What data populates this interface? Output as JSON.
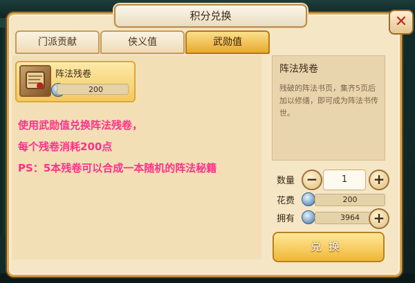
{
  "dialog": {
    "title": "积分兑换"
  },
  "tabs": [
    {
      "label": "门派贡献",
      "active": false
    },
    {
      "label": "侠义值",
      "active": false
    },
    {
      "label": "武勋值",
      "active": true
    }
  ],
  "item": {
    "name": "阵法残卷",
    "price": "200"
  },
  "description": {
    "line1": "使用武勋值兑换阵法残卷，",
    "line2": "每个残卷消耗200点",
    "line3": "PS：5本残卷可以合成一本随机的阵法秘籍"
  },
  "detail": {
    "title": "阵法残卷",
    "desc": "残破的阵法书页，集齐5页后加以修缮，即可成为阵法书传世。"
  },
  "quantity": {
    "label": "数量",
    "value": "1",
    "minus": "−",
    "plus": "+"
  },
  "cost": {
    "label": "花费",
    "value": "200"
  },
  "owned": {
    "label": "拥有",
    "value": "3964",
    "plus": "+"
  },
  "exchange_button": "兑换",
  "colors": {
    "accent_pink": "#ff2f8a",
    "tab_active": "#e7a92e",
    "close_x": "#c2261b"
  }
}
